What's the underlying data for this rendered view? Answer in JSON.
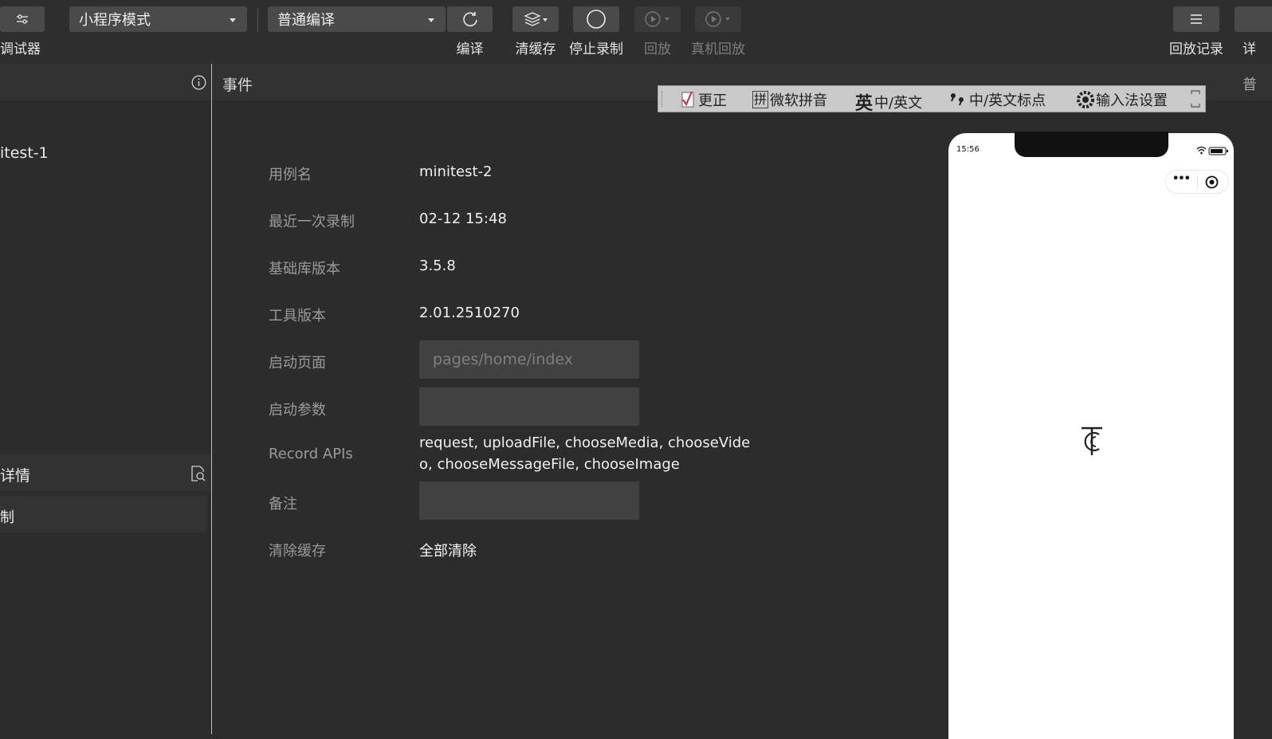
{
  "toolbar": {
    "debugger_label": "调试器",
    "mode_select": "小程序模式",
    "compile_select": "普通编译",
    "compile_label": "编译",
    "clear_cache_label": "清缓存",
    "stop_record_label": "停止录制",
    "replay_label": "回放",
    "device_replay_label": "真机回放",
    "replay_history_label": "回放记录",
    "right_cut_char": "详"
  },
  "left_panel": {
    "item_1": "itest-1",
    "section_title": "详情",
    "section_item": "制"
  },
  "main": {
    "header_title": "事件",
    "right_cut_char": "普",
    "fields": [
      {
        "label": "用例名",
        "value": "minitest-2"
      },
      {
        "label": "最近一次录制",
        "value": "02-12 15:48"
      },
      {
        "label": "基础库版本",
        "value": "3.5.8"
      },
      {
        "label": "工具版本",
        "value": "2.01.2510270"
      },
      {
        "label": "启动页面",
        "placeholder": "pages/home/index"
      },
      {
        "label": "启动参数",
        "placeholder": ""
      },
      {
        "label": "Record APIs",
        "value_line1": "request, uploadFile, chooseMedia, chooseVide",
        "value_line2": "o, chooseMessageFile, chooseImage"
      },
      {
        "label": "备注",
        "placeholder": ""
      },
      {
        "label": "清除缓存",
        "value": "全部清除"
      }
    ]
  },
  "ime_bar": {
    "items": [
      "更正",
      "微软拼音",
      "中/英文",
      "中/英文标点",
      "输入法设置"
    ],
    "glyphs": {
      "pinyin": "拼",
      "english": "英"
    }
  },
  "simulator": {
    "time": "15:56",
    "more_glyph": "•••"
  },
  "colors": {
    "background": "#2c2c2c",
    "button_bg": "#4a4a4a",
    "input_bg": "#414141",
    "ime_bg": "#c9c9c9",
    "phone_bg": "#ffffff"
  }
}
